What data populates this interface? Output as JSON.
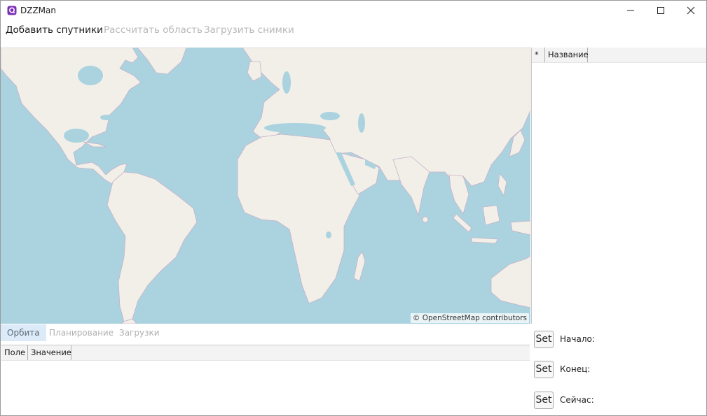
{
  "window": {
    "title": "DZZMan"
  },
  "menu": {
    "add_satellites": "Добавить спутники",
    "calc_area": "Рассчитать область",
    "load_images": "Загрузить снимки"
  },
  "map": {
    "attribution": "© OpenStreetMap contributors"
  },
  "satellite_table": {
    "columns": [
      "*",
      "Название"
    ]
  },
  "tabs": [
    {
      "label": "Орбита",
      "active": true
    },
    {
      "label": "Планирование",
      "active": false
    },
    {
      "label": "Загрузки",
      "active": false
    }
  ],
  "properties_table": {
    "columns": [
      "Поле",
      "Значение"
    ]
  },
  "time_controls": [
    {
      "button": "Set",
      "label": "Начало:"
    },
    {
      "button": "Set",
      "label": "Конец:"
    },
    {
      "button": "Set",
      "label": "Сейчас:"
    }
  ],
  "colors": {
    "ocean": "#aad3df",
    "land": "#f2efe9",
    "border": "#c8b0c8",
    "accent": "#7a2fb5"
  }
}
